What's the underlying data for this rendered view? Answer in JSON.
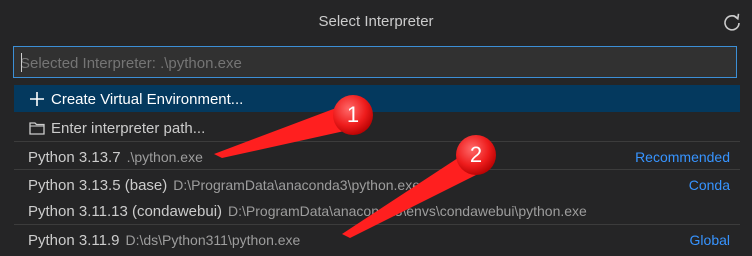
{
  "title": "Select Interpreter",
  "icons": {
    "refresh": "refresh-icon",
    "plus": "plus-icon",
    "folder": "folder-icon"
  },
  "search": {
    "placeholder": "Selected Interpreter: .\\python.exe",
    "value": ""
  },
  "items": [
    {
      "label": "Create Virtual Environment...",
      "icon": "plus-icon"
    },
    {
      "label": "Enter interpreter path...",
      "icon": "folder-icon"
    },
    {
      "label": "Python 3.13.7",
      "desc": ".\\python.exe",
      "tag": "Recommended"
    },
    {
      "label": "Python 3.13.5 (base)",
      "desc": "D:\\ProgramData\\anaconda3\\python.exe",
      "tag": "Conda"
    },
    {
      "label": "Python 3.11.13 (condawebui)",
      "desc": "D:\\ProgramData\\anaconda3\\envs\\condawebui\\python.exe",
      "tag": ""
    },
    {
      "label": "Python 3.11.9",
      "desc": "D:\\ds\\Python311\\python.exe",
      "tag": "Global"
    }
  ],
  "annotations": [
    "1",
    "2"
  ],
  "colors": {
    "accent": "#3794ff",
    "selection": "#04395e",
    "annotation": "#ff1f1f"
  }
}
